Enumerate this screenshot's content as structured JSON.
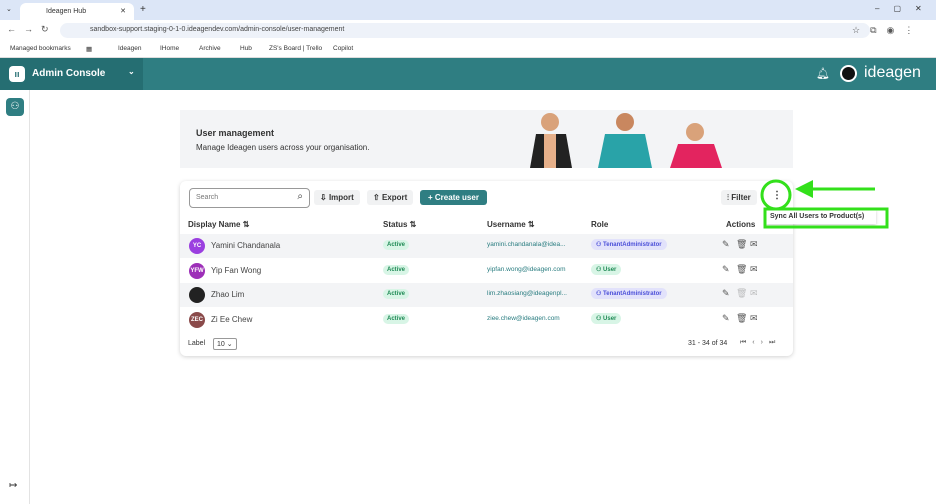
{
  "browser": {
    "tab_title": "Ideagen Hub",
    "url": "sandbox-support.staging-0-1-0.ideagendev.com/admin-console/user-management",
    "bookmarks": [
      "Managed bookmarks",
      "Ideagen",
      "IHome",
      "Archive",
      "Hub",
      "ZS's Board | Trello",
      "Copilot"
    ]
  },
  "header": {
    "app_title": "Admin Console",
    "brand": "ideagen"
  },
  "banner": {
    "title": "User management",
    "subtitle": "Manage Ideagen users across your organisation."
  },
  "toolbar": {
    "search_placeholder": "Search",
    "import": "Import",
    "export": "Export",
    "create": "Create user",
    "filter": "Filter",
    "menu_item": "Sync All Users to Product(s)"
  },
  "table": {
    "columns": [
      "Display Name",
      "Status",
      "Username",
      "Role",
      "Actions"
    ],
    "rows": [
      {
        "initials": "YC",
        "name": "Yamini Chandanala",
        "status": "Active",
        "username": "yamini.chandanala@idea...",
        "role": "TenantAdministrator",
        "color": "#9b3fe0"
      },
      {
        "initials": "YFW",
        "name": "Yip Fan Wong",
        "status": "Active",
        "username": "yipfan.wong@ideagen.com",
        "role": "User",
        "color": "#9d2fb8"
      },
      {
        "initials": "",
        "name": "Zhao Lim",
        "status": "Active",
        "username": "lim.zhaosiang@ideagenpl...",
        "role": "TenantAdministrator",
        "color": "#222"
      },
      {
        "initials": "ZEC",
        "name": "Zi Ee Chew",
        "status": "Active",
        "username": "ziee.chew@ideagen.com",
        "role": "User",
        "color": "#8a4a4a"
      }
    ]
  },
  "footer": {
    "label": "Label",
    "page_size": "10",
    "range": "31 - 34 of 34"
  },
  "colors": {
    "teal": "#2f7e82",
    "annotation": "#33e01b"
  }
}
